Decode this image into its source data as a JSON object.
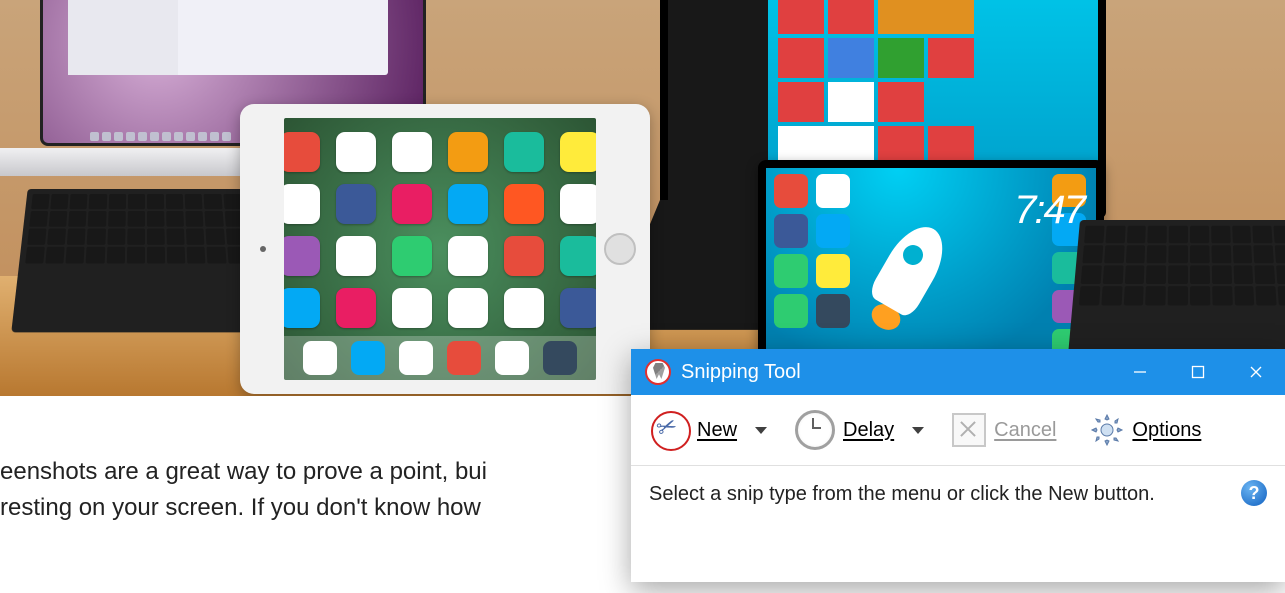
{
  "android": {
    "time": "7:47"
  },
  "article": {
    "line1": "eenshots are a great way to prove a point, bui",
    "line2": "resting on your screen. If you don't know how"
  },
  "snip": {
    "title": "Snipping Tool",
    "toolbar": {
      "new": "New",
      "delay": "Delay",
      "cancel": "Cancel",
      "options": "Options"
    },
    "status": "Select a snip type from the menu or click the New button."
  }
}
